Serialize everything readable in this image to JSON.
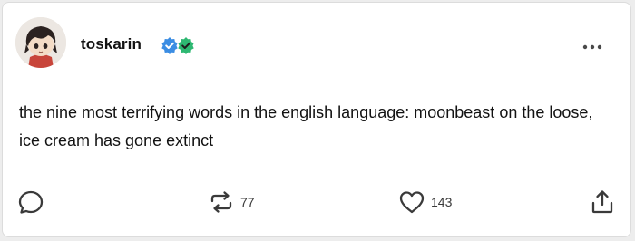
{
  "post": {
    "author": {
      "username": "toskarin",
      "badges": [
        "blue-check-badge-icon",
        "green-check-badge-icon"
      ]
    },
    "text": "the nine most terrifying words in the english language: moonbeast on the loose, ice cream has gone extinct",
    "actions": {
      "reply_icon": "comment-bubble-icon",
      "reblog_icon": "reblog-icon",
      "reblog_count": "77",
      "like_icon": "heart-icon",
      "like_count": "143",
      "share_icon": "share-icon",
      "more_icon": "more-options-icon"
    }
  },
  "colors": {
    "badge_blue": "#3b8de3",
    "badge_green": "#2eb872",
    "text": "#121212",
    "icon": "#3a3a3a"
  }
}
